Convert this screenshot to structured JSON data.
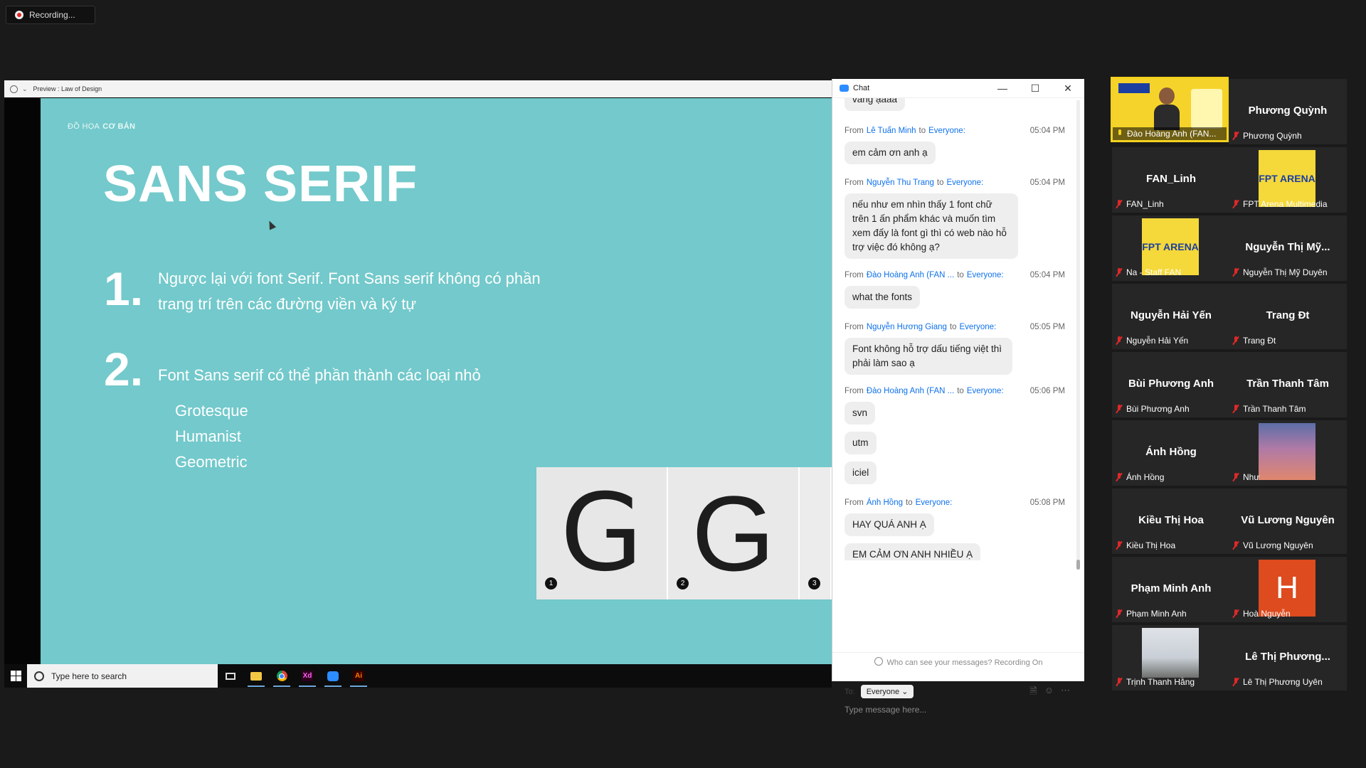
{
  "recording": {
    "label": "Recording..."
  },
  "preview_bar": {
    "title": "Preview : Law of Design"
  },
  "slide": {
    "brand_light": "ĐỒ HỌA",
    "brand_bold": "CƠ BẢN",
    "title": "SANS SERIF",
    "points": [
      {
        "num": "1.",
        "text_line1": "Ngược lại với font Serif. Font Sans serif không có phần",
        "text_line2": "trang trí trên các đường viền và ký tự"
      },
      {
        "num": "2.",
        "text_line1": "Font Sans serif có thể phần thành các loại nhỏ",
        "text_line2": ""
      }
    ],
    "subitems": [
      "Grotesque",
      "Humanist",
      "Geometric"
    ],
    "samples": [
      {
        "letter": "G",
        "badge": "1"
      },
      {
        "letter": "G",
        "badge": "2"
      },
      {
        "letter": "",
        "badge": "3"
      }
    ]
  },
  "taskbar": {
    "search_placeholder": "Type here to search",
    "apps": [
      "task-view",
      "file-explorer",
      "chrome",
      "adobe-xd",
      "zoom",
      "illustrator"
    ],
    "xd_label": "Xd",
    "ai_label": "Ai"
  },
  "chat": {
    "title": "Chat",
    "partial_top": "vâng ạaaa",
    "messages": [
      {
        "from_label": "From",
        "sender": "Lê Tuấn Minh",
        "to_label": "to",
        "recipient": "Everyone:",
        "time": "05:04 PM",
        "bubbles": [
          "em cảm ơn anh ạ"
        ]
      },
      {
        "from_label": "From",
        "sender": "Nguyễn Thu Trang",
        "to_label": "to",
        "recipient": "Everyone:",
        "time": "05:04 PM",
        "bubbles": [
          "nếu như em nhìn thấy 1 font chữ trên 1 ấn phẩm khác và muốn tìm xem đấy là font gì thì có web nào hỗ trợ việc đó không ạ?"
        ]
      },
      {
        "from_label": "From",
        "sender": "Đào Hoàng Anh (FAN ...",
        "to_label": "to",
        "recipient": "Everyone:",
        "time": "05:04 PM",
        "bubbles": [
          "what the fonts"
        ]
      },
      {
        "from_label": "From",
        "sender": "Nguyễn Hương Giang",
        "to_label": "to",
        "recipient": "Everyone:",
        "time": "05:05 PM",
        "bubbles": [
          "Font không hỗ trợ dấu tiếng việt thì phải làm sao ạ"
        ]
      },
      {
        "from_label": "From",
        "sender": "Đào Hoàng Anh (FAN ...",
        "to_label": "to",
        "recipient": "Everyone:",
        "time": "05:06 PM",
        "bubbles": [
          "svn",
          "utm",
          "iciel"
        ]
      },
      {
        "from_label": "From",
        "sender": "Ánh Hồng",
        "to_label": "to",
        "recipient": "Everyone:",
        "time": "05:08 PM",
        "bubbles": [
          "HAY QUÁ ANH Ạ",
          "EM CẢM ƠN ANH NHIỀU Ạ"
        ]
      }
    ],
    "notice": "Who can see your messages? Recording On",
    "to_label": "To:",
    "to_value": "Everyone",
    "input_placeholder": "Type message here..."
  },
  "participants": [
    {
      "display": "",
      "label": "Đào Hoàng Anh (FAN...",
      "video": true,
      "muted": false
    },
    {
      "display": "Phương Quỳnh",
      "label": "Phương Quỳnh",
      "muted": true
    },
    {
      "display": "FAN_Linh",
      "label": "FAN_Linh",
      "muted": true
    },
    {
      "display": "",
      "label": "FPT Arena Multimedia",
      "muted": true,
      "thumb": "poster",
      "poster_text": "FPT ARENA"
    },
    {
      "display": "",
      "label": "Na - Staff FAN",
      "muted": true,
      "thumb": "poster",
      "poster_text": "FPT ARENA"
    },
    {
      "display": "Nguyễn Thị Mỹ...",
      "label": "Nguyễn Thị Mỹ Duyên",
      "muted": true
    },
    {
      "display": "Nguyễn Hải Yến",
      "label": "Nguyễn Hải Yến",
      "muted": true
    },
    {
      "display": "Trang Đt",
      "label": "Trang Đt",
      "muted": true
    },
    {
      "display": "Bùi Phương Anh",
      "label": "Bùi Phương Anh",
      "muted": true
    },
    {
      "display": "Trần Thanh Tâm",
      "label": "Trần Thanh Tâm",
      "muted": true
    },
    {
      "display": "Ánh Hồng",
      "label": "Ánh Hồng",
      "muted": true
    },
    {
      "display": "",
      "label": "Như",
      "muted": true,
      "thumb": "sky"
    },
    {
      "display": "Kiều Thị Hoa",
      "label": "Kiều Thị Hoa",
      "muted": true
    },
    {
      "display": "Vũ Lương Nguyên",
      "label": "Vũ Lương Nguyên",
      "muted": true
    },
    {
      "display": "Phạm Minh Anh",
      "label": "Phạm Minh Anh",
      "muted": true
    },
    {
      "display": "",
      "label": "Hoà Nguyễn",
      "muted": true,
      "thumb": "letter",
      "letter": "H"
    },
    {
      "display": "",
      "label": "Trịnh Thanh Hằng",
      "muted": true,
      "thumb": "mountain"
    },
    {
      "display": "Lê Thị Phương...",
      "label": "Lê Thị Phương Uyên",
      "muted": true
    }
  ],
  "colors": {
    "slide_bg": "#73c9cb",
    "accent_blue": "#0e71eb",
    "active_speaker": "#f4d21f",
    "mute_red": "#e02828"
  }
}
